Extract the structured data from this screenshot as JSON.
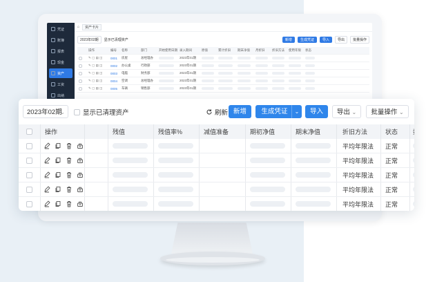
{
  "mini_app": {
    "sidebar": [
      "凭证",
      "账簿",
      "报表",
      "现金",
      "资产",
      "工资",
      "出纳",
      "发票",
      "工具"
    ],
    "active_index": 4,
    "tab": "资产卡片",
    "period": "2023年02期",
    "show_cleared": "显示已清理资产",
    "buttons": [
      "新增",
      "生成凭证",
      "导入",
      "导出",
      "批量操作"
    ],
    "headers": [
      "操作",
      "编号",
      "名称",
      "部门",
      "开始使用日期",
      "录入期间",
      "原值",
      "累计折旧",
      "期末净值",
      "月折旧",
      "折旧方法",
      "使用年限",
      "状态"
    ],
    "rows": [
      {
        "code": "0001",
        "name": "房屋",
        "dept": "总经理办",
        "date": "2023年01期"
      },
      {
        "code": "0002",
        "name": "办公桌",
        "dept": "行政部",
        "date": "2023年01期"
      },
      {
        "code": "0003",
        "name": "电脑",
        "dept": "财务部",
        "date": "2023年01期"
      },
      {
        "code": "0004",
        "name": "空调",
        "dept": "总经理办",
        "date": "2023年01期"
      },
      {
        "code": "0005",
        "name": "车辆",
        "dept": "销售部",
        "date": "2023年01期"
      }
    ]
  },
  "toolbar": {
    "period": "2023年02期",
    "show_cleared": "显示已清理资产",
    "refresh": "刷新",
    "add": "新增",
    "generate": "生成凭证",
    "import": "导入",
    "export": "导出",
    "batch": "批量操作"
  },
  "table": {
    "headers": {
      "ops": "操作",
      "residual": "残值",
      "residual_rate": "残值率%",
      "impairment": "减值准备",
      "begin_net": "期初净值",
      "end_net": "期末净值",
      "method": "折旧方法",
      "status": "状态",
      "qty": "数量"
    },
    "rows": [
      {
        "method": "平均年限法",
        "status": "正常"
      },
      {
        "method": "平均年限法",
        "status": "正常"
      },
      {
        "method": "平均年限法",
        "status": "正常"
      },
      {
        "method": "平均年限法",
        "status": "正常"
      },
      {
        "method": "平均年限法",
        "status": "正常"
      }
    ]
  },
  "colors": {
    "accent": "#2f86eb",
    "sidebar": "#1e2a3b"
  }
}
